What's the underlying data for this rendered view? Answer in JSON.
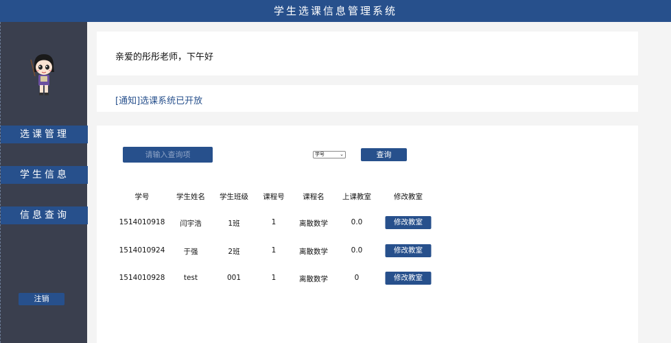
{
  "header": {
    "title": "学生选课信息管理系统"
  },
  "sidebar": {
    "avatar": "teacher-avatar",
    "items": [
      {
        "label": "选课管理"
      },
      {
        "label": "学生信息"
      },
      {
        "label": "信息查询"
      }
    ],
    "logout_label": "注销"
  },
  "greeting": {
    "text": "亲爱的彤彤老师，下午好"
  },
  "notice": {
    "text": "[通知]选课系统已开放"
  },
  "search": {
    "placeholder": "请输入查询项",
    "select_value": "学号",
    "query_label": "查询"
  },
  "table": {
    "columns": [
      "学号",
      "学生姓名",
      "学生班级",
      "课程号",
      "课程名",
      "上课教室",
      "修改教室"
    ],
    "rows": [
      {
        "student_id": "1514010918",
        "name": "闫宇浩",
        "class": "1班",
        "course_no": "1",
        "course_name": "离散数学",
        "classroom": "0.0",
        "action": "修改教室"
      },
      {
        "student_id": "1514010924",
        "name": "于强",
        "class": "2班",
        "course_no": "1",
        "course_name": "离散数学",
        "classroom": "0.0",
        "action": "修改教室"
      },
      {
        "student_id": "1514010928",
        "name": "test",
        "class": "001",
        "course_no": "1",
        "course_name": "离散数学",
        "classroom": "0",
        "action": "修改教室"
      }
    ]
  },
  "colors": {
    "primary": "#27508c",
    "sidebar": "#3a3f4e",
    "background": "#f4f4f4"
  }
}
